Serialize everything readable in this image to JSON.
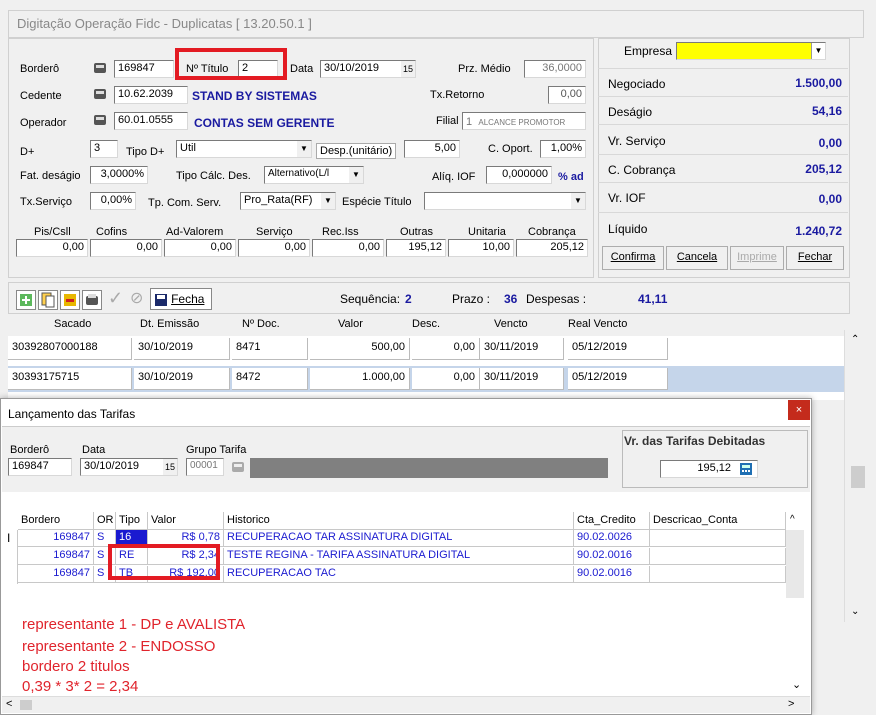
{
  "window": {
    "title": "Digitação Operação Fidc - Duplicatas [ 13.20.50.1 ]"
  },
  "form": {
    "bordero_label": "Borderô",
    "bordero_value": "169847",
    "n_titulo_label": "Nº Título",
    "n_titulo_value": "2",
    "data_label": "Data",
    "data_value": "30/10/2019",
    "prz_medio_label": "Prz. Médio",
    "prz_medio_value": "36,0000",
    "cedente_label": "Cedente",
    "cedente_code": "10.62.2039",
    "cedente_name": "STAND BY SISTEMAS",
    "tx_retorno_label": "Tx.Retorno",
    "tx_retorno_value": "0,00",
    "operador_label": "Operador",
    "operador_code": "60.01.0555",
    "operador_name": "CONTAS SEM GERENTE",
    "filial_label": "Filial",
    "filial_value": "1",
    "filial_desc": "ALCANCE PROMOTOR",
    "d_plus_label": "D+",
    "d_plus_value": "3",
    "tipo_d_label": "Tipo D+",
    "tipo_d_value": "Util",
    "desp_unit_label": "Desp.(unitário)",
    "desp_unit_value": "5,00",
    "c_oport_label": "C. Oport.",
    "c_oport_value": "1,00%",
    "fat_desagio_label": "Fat. deságio",
    "fat_desagio_value": "3,0000%",
    "tipo_calc_label": "Tipo Cálc. Des.",
    "tipo_calc_value": "Alternativo(L/l",
    "aliq_iof_label": "Alíq. IOF",
    "aliq_iof_value": "0,000000",
    "aliq_iof_unit": "% ad",
    "tx_servico_label": "Tx.Serviço",
    "tx_servico_value": "0,00%",
    "tp_com_serv_label": "Tp. Com. Serv.",
    "tp_com_serv_value": "Pro_Rata(RF)",
    "especie_label": "Espécie Título",
    "especie_value": "",
    "taxes": [
      {
        "label": "Pis/Csll",
        "value": "0,00"
      },
      {
        "label": "Cofins",
        "value": "0,00"
      },
      {
        "label": "Ad-Valorem",
        "value": "0,00"
      },
      {
        "label": "Serviço",
        "value": "0,00"
      },
      {
        "label": "Rec.Iss",
        "value": "0,00"
      },
      {
        "label": "Outras",
        "value": "195,12"
      },
      {
        "label": "Unitaria",
        "value": "10,00"
      },
      {
        "label": "Cobrança",
        "value": "205,12"
      }
    ]
  },
  "summary": {
    "empresa_label": "Empresa",
    "empresa_value": "",
    "rows": [
      {
        "label": "Negociado",
        "value": "1.500,00"
      },
      {
        "label": "Deságio",
        "value": "54,16"
      },
      {
        "label": "Vr. Serviço",
        "value": "0,00"
      },
      {
        "label": "C. Cobrança",
        "value": "205,12"
      },
      {
        "label": "Vr. IOF",
        "value": "0,00"
      },
      {
        "label": "Líquido",
        "value": "1.240,72"
      }
    ],
    "buttons": {
      "confirma": "Confirma",
      "cancela": "Cancela",
      "imprime": "Imprime",
      "fechar": "Fechar"
    }
  },
  "toolbar": {
    "fecha_label": "Fecha",
    "sequencia_label": "Sequência:",
    "sequencia_value": "2",
    "prazo_label": "Prazo :",
    "prazo_value": "36",
    "despesas_label": "Despesas :",
    "despesas_value": "41,11"
  },
  "titles_grid": {
    "headers": [
      "Sacado",
      "Dt. Emissão",
      "Nº Doc.",
      "Valor",
      "Desc.",
      "Vencto",
      "Real Vencto"
    ],
    "rows": [
      [
        "30392807000188",
        "30/10/2019",
        "8471",
        "500,00",
        "0,00",
        "30/11/2019",
        "05/12/2019"
      ],
      [
        "30393175715",
        "30/10/2019",
        "8472",
        "1.000,00",
        "0,00",
        "30/11/2019",
        "05/12/2019"
      ]
    ]
  },
  "tarifas_dialog": {
    "title": "Lançamento das Tarifas",
    "bordero_label": "Borderô",
    "bordero_value": "169847",
    "data_label": "Data",
    "data_value": "30/10/2019",
    "grupo_label": "Grupo Tarifa",
    "grupo_value": "00001",
    "vr_label": "Vr. das Tarifas Debitadas",
    "vr_value": "195,12",
    "headers": [
      "Bordero",
      "OR",
      "Tipo",
      "Valor",
      "Historico",
      "Cta_Credito",
      "Descricao_Conta"
    ],
    "rows": [
      [
        "169847",
        "S",
        "16",
        "R$ 0,78",
        "RECUPERACAO TAR ASSINATURA DIGITAL",
        "90.02.0026",
        ""
      ],
      [
        "169847",
        "S",
        "RE",
        "R$ 2,34",
        "TESTE REGINA - TARIFA ASSINATURA DIGITAL",
        "90.02.0016",
        ""
      ],
      [
        "169847",
        "S",
        "TB",
        "R$ 192,00",
        "RECUPERACAO TAC",
        "90.02.0016",
        ""
      ]
    ],
    "notes": [
      "representante 1 - DP e AVALISTA",
      "representante 2 - ENDOSSO",
      "bordero 2 titulos",
      "0,39 * 3* 2 = 2,34"
    ]
  },
  "colors": {
    "accent_blue": "#1a1aa0",
    "annotation_red": "#e31b23",
    "selected_row": "#c5d5ea",
    "empresa_yellow": "#ffff00"
  }
}
